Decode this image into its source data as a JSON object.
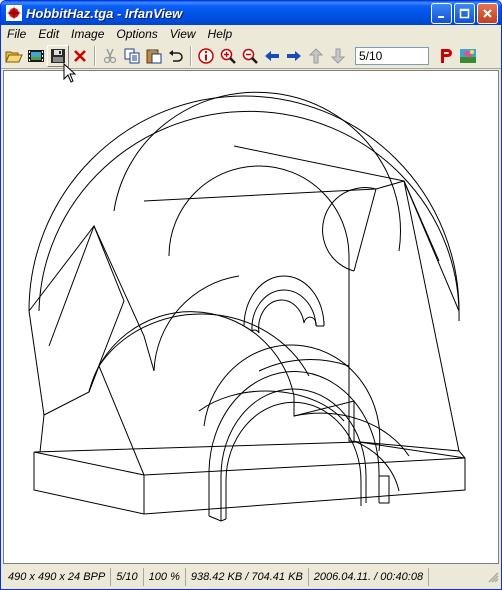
{
  "window": {
    "title": "HobbitHaz.tga - IrfanView"
  },
  "menu": [
    {
      "label": "File"
    },
    {
      "label": "Edit"
    },
    {
      "label": "Image"
    },
    {
      "label": "Options"
    },
    {
      "label": "View"
    },
    {
      "label": "Help"
    }
  ],
  "toolbar": {
    "page_indicator": "5/10",
    "icons": [
      "open-folder-icon",
      "slideshow-icon",
      "save-icon",
      "delete-icon",
      "cut-icon",
      "copy-icon",
      "paste-icon",
      "undo-icon",
      "info-icon",
      "zoom-in-icon",
      "zoom-out-icon",
      "previous-icon",
      "next-icon",
      "page-up-icon",
      "page-down-icon",
      "print-icon",
      "paint-icon"
    ]
  },
  "status": {
    "dimensions": "490 x 490 x 24 BPP",
    "page": "5/10",
    "zoom": "100 %",
    "size": "938.42 KB / 704.41 KB",
    "datetime": "2006.04.11. / 00:40:08"
  },
  "colors": {
    "title_bar": "#0a5ef8",
    "close_button": "#c13f1e",
    "accent_red": "#cc0000"
  }
}
